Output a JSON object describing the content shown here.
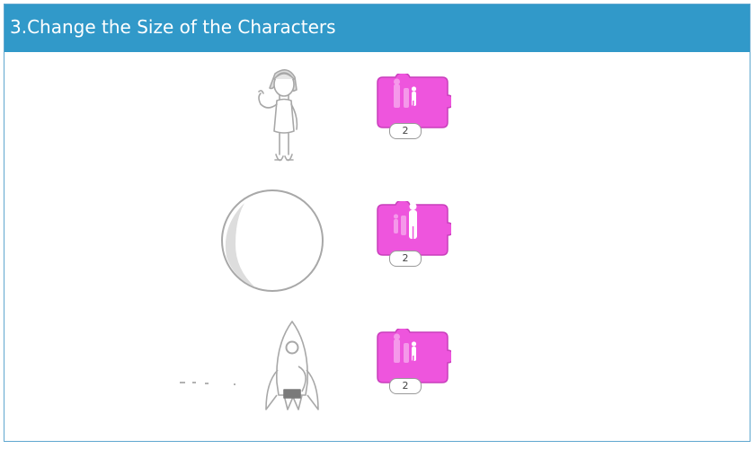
{
  "header": {
    "title": "3.Change the Size of the Characters"
  },
  "rows": [
    {
      "character": "girl-icon",
      "block_icon": "shrink-icon",
      "value": "2"
    },
    {
      "character": "ball-icon",
      "block_icon": "grow-icon",
      "value": "2"
    },
    {
      "character": "rocket-icon",
      "block_icon": "shrink-icon",
      "value": "2"
    }
  ],
  "colors": {
    "header": "#3199c9",
    "block": "#ee55dd",
    "outline": "#a8a8a8"
  }
}
